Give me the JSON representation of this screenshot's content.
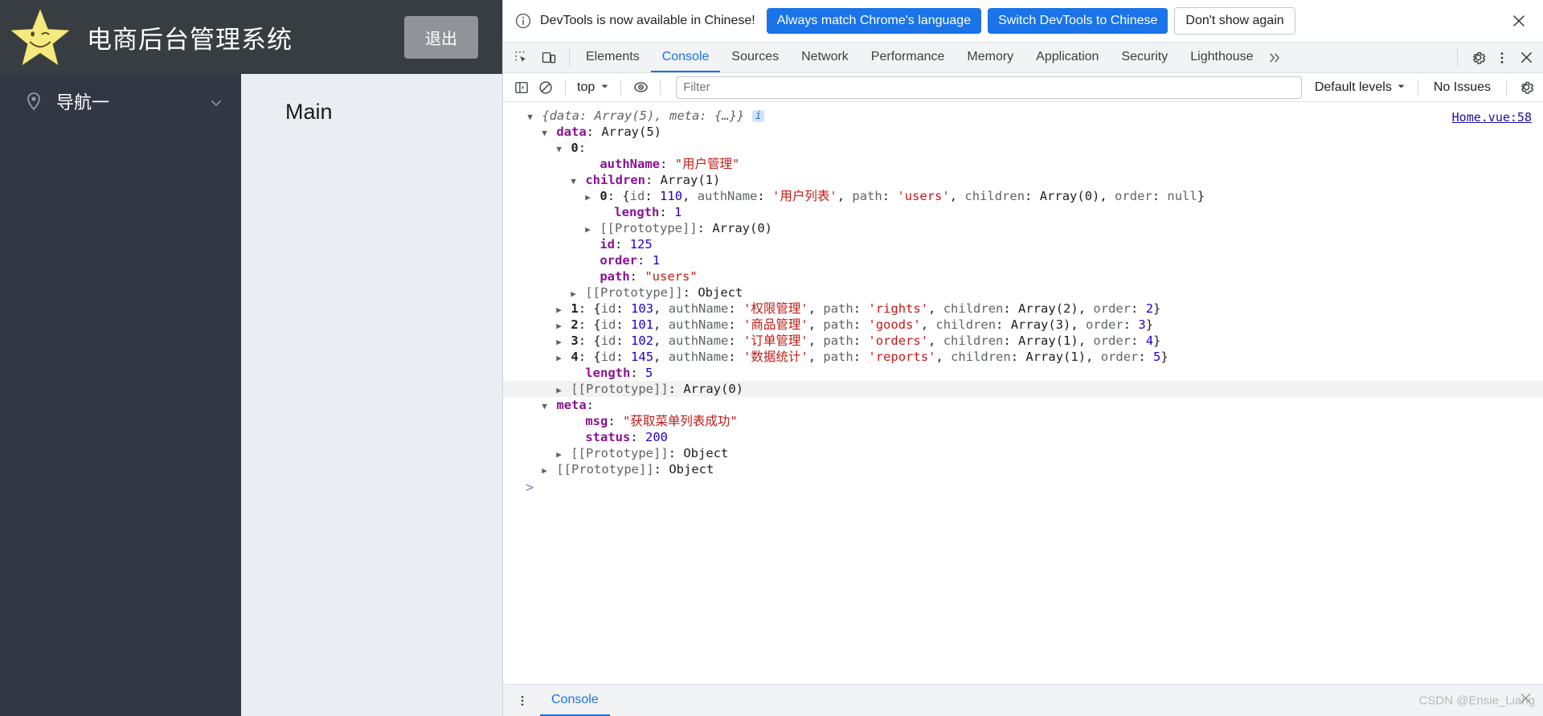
{
  "app": {
    "title": "电商后台管理系统",
    "logout_label": "退出",
    "logo": "star-smiley-logo",
    "sidebar": {
      "items": [
        {
          "label": "导航一",
          "icon": "location-pin-icon",
          "chevron": "chevron-down-icon"
        }
      ]
    },
    "main": {
      "heading": "Main"
    }
  },
  "devtools": {
    "infobar": {
      "icon": "info-circle-icon",
      "message": "DevTools is now available in Chinese!",
      "primary_button": "Always match Chrome's language",
      "secondary_button": "Switch DevTools to Chinese",
      "dismiss_button": "Don't show again",
      "close_icon": "close-icon"
    },
    "tabstrip": {
      "inspect_icon": "inspect-element-icon",
      "device_icon": "device-toolbar-icon",
      "tabs": [
        {
          "label": "Elements",
          "active": false
        },
        {
          "label": "Console",
          "active": true
        },
        {
          "label": "Sources",
          "active": false
        },
        {
          "label": "Network",
          "active": false
        },
        {
          "label": "Performance",
          "active": false
        },
        {
          "label": "Memory",
          "active": false
        },
        {
          "label": "Application",
          "active": false
        },
        {
          "label": "Security",
          "active": false
        },
        {
          "label": "Lighthouse",
          "active": false
        }
      ],
      "more_tabs_icon": "chevron-double-right-icon",
      "settings_icon": "gear-icon",
      "kebab_icon": "more-vertical-icon",
      "close_icon": "close-icon"
    },
    "console_toolbar": {
      "sidebar_icon": "console-sidebar-icon",
      "clear_icon": "clear-console-icon",
      "context_value": "top",
      "context_chevron": "chevron-down-icon",
      "eye_icon": "live-expression-eye-icon",
      "filter_placeholder": "Filter",
      "filter_value": "",
      "levels_value": "Default levels",
      "levels_chevron": "chevron-down-icon",
      "issues_label": "No Issues",
      "settings_icon": "gear-icon"
    },
    "console_output": {
      "source_link": "Home.vue:58",
      "lines": [
        {
          "id": "l0",
          "indent": 0,
          "arrow": "down",
          "tokens": [
            {
              "t": "{data: Array(5), meta: {…}} ",
              "c": "preview"
            },
            {
              "t": "i",
              "c": "badge"
            }
          ]
        },
        {
          "id": "l1",
          "indent": 1,
          "arrow": "down",
          "tokens": [
            {
              "t": "data",
              "c": "key"
            },
            {
              "t": ": ",
              "c": "plain"
            },
            {
              "t": "Array(5)",
              "c": "plain"
            }
          ]
        },
        {
          "id": "l2",
          "indent": 2,
          "arrow": "down",
          "tokens": [
            {
              "t": "0",
              "c": "idx"
            },
            {
              "t": ":",
              "c": "plain"
            }
          ]
        },
        {
          "id": "l3",
          "indent": 4,
          "arrow": "none",
          "tokens": [
            {
              "t": "authName",
              "c": "key"
            },
            {
              "t": ": ",
              "c": "plain"
            },
            {
              "t": "\"用户管理\"",
              "c": "str"
            }
          ]
        },
        {
          "id": "l4",
          "indent": 3,
          "arrow": "down",
          "tokens": [
            {
              "t": "children",
              "c": "key"
            },
            {
              "t": ": ",
              "c": "plain"
            },
            {
              "t": "Array(1)",
              "c": "plain"
            }
          ]
        },
        {
          "id": "l5",
          "indent": 4,
          "arrow": "right",
          "tokens": [
            {
              "t": "0",
              "c": "idx"
            },
            {
              "t": ": {",
              "c": "plain"
            },
            {
              "t": "id",
              "c": "grey"
            },
            {
              "t": ": ",
              "c": "plain"
            },
            {
              "t": "110",
              "c": "num"
            },
            {
              "t": ", ",
              "c": "plain"
            },
            {
              "t": "authName",
              "c": "grey"
            },
            {
              "t": ": ",
              "c": "plain"
            },
            {
              "t": "'用户列表'",
              "c": "str"
            },
            {
              "t": ", ",
              "c": "plain"
            },
            {
              "t": "path",
              "c": "grey"
            },
            {
              "t": ": ",
              "c": "plain"
            },
            {
              "t": "'users'",
              "c": "str"
            },
            {
              "t": ", ",
              "c": "plain"
            },
            {
              "t": "children",
              "c": "grey"
            },
            {
              "t": ": ",
              "c": "plain"
            },
            {
              "t": "Array(0)",
              "c": "plain"
            },
            {
              "t": ", ",
              "c": "plain"
            },
            {
              "t": "order",
              "c": "grey"
            },
            {
              "t": ": ",
              "c": "plain"
            },
            {
              "t": "null",
              "c": "null"
            },
            {
              "t": "}",
              "c": "plain"
            }
          ]
        },
        {
          "id": "l6",
          "indent": 5,
          "arrow": "none",
          "tokens": [
            {
              "t": "length",
              "c": "key"
            },
            {
              "t": ": ",
              "c": "plain"
            },
            {
              "t": "1",
              "c": "num"
            }
          ]
        },
        {
          "id": "l7",
          "indent": 4,
          "arrow": "right",
          "tokens": [
            {
              "t": "[[Prototype]]",
              "c": "grey"
            },
            {
              "t": ": ",
              "c": "plain"
            },
            {
              "t": "Array(0)",
              "c": "plain"
            }
          ]
        },
        {
          "id": "l8",
          "indent": 4,
          "arrow": "none",
          "tokens": [
            {
              "t": "id",
              "c": "key"
            },
            {
              "t": ": ",
              "c": "plain"
            },
            {
              "t": "125",
              "c": "num"
            }
          ]
        },
        {
          "id": "l9",
          "indent": 4,
          "arrow": "none",
          "tokens": [
            {
              "t": "order",
              "c": "key"
            },
            {
              "t": ": ",
              "c": "plain"
            },
            {
              "t": "1",
              "c": "num"
            }
          ]
        },
        {
          "id": "l10",
          "indent": 4,
          "arrow": "none",
          "tokens": [
            {
              "t": "path",
              "c": "key"
            },
            {
              "t": ": ",
              "c": "plain"
            },
            {
              "t": "\"users\"",
              "c": "str"
            }
          ]
        },
        {
          "id": "l11",
          "indent": 3,
          "arrow": "right",
          "tokens": [
            {
              "t": "[[Prototype]]",
              "c": "grey"
            },
            {
              "t": ": ",
              "c": "plain"
            },
            {
              "t": "Object",
              "c": "plain"
            }
          ]
        },
        {
          "id": "l12",
          "indent": 2,
          "arrow": "right",
          "tokens": [
            {
              "t": "1",
              "c": "idx"
            },
            {
              "t": ": {",
              "c": "plain"
            },
            {
              "t": "id",
              "c": "grey"
            },
            {
              "t": ": ",
              "c": "plain"
            },
            {
              "t": "103",
              "c": "num"
            },
            {
              "t": ", ",
              "c": "plain"
            },
            {
              "t": "authName",
              "c": "grey"
            },
            {
              "t": ": ",
              "c": "plain"
            },
            {
              "t": "'权限管理'",
              "c": "str"
            },
            {
              "t": ", ",
              "c": "plain"
            },
            {
              "t": "path",
              "c": "grey"
            },
            {
              "t": ": ",
              "c": "plain"
            },
            {
              "t": "'rights'",
              "c": "str"
            },
            {
              "t": ", ",
              "c": "plain"
            },
            {
              "t": "children",
              "c": "grey"
            },
            {
              "t": ": ",
              "c": "plain"
            },
            {
              "t": "Array(2)",
              "c": "plain"
            },
            {
              "t": ", ",
              "c": "plain"
            },
            {
              "t": "order",
              "c": "grey"
            },
            {
              "t": ": ",
              "c": "plain"
            },
            {
              "t": "2",
              "c": "num"
            },
            {
              "t": "}",
              "c": "plain"
            }
          ]
        },
        {
          "id": "l13",
          "indent": 2,
          "arrow": "right",
          "tokens": [
            {
              "t": "2",
              "c": "idx"
            },
            {
              "t": ": {",
              "c": "plain"
            },
            {
              "t": "id",
              "c": "grey"
            },
            {
              "t": ": ",
              "c": "plain"
            },
            {
              "t": "101",
              "c": "num"
            },
            {
              "t": ", ",
              "c": "plain"
            },
            {
              "t": "authName",
              "c": "grey"
            },
            {
              "t": ": ",
              "c": "plain"
            },
            {
              "t": "'商品管理'",
              "c": "str"
            },
            {
              "t": ", ",
              "c": "plain"
            },
            {
              "t": "path",
              "c": "grey"
            },
            {
              "t": ": ",
              "c": "plain"
            },
            {
              "t": "'goods'",
              "c": "str"
            },
            {
              "t": ", ",
              "c": "plain"
            },
            {
              "t": "children",
              "c": "grey"
            },
            {
              "t": ": ",
              "c": "plain"
            },
            {
              "t": "Array(3)",
              "c": "plain"
            },
            {
              "t": ", ",
              "c": "plain"
            },
            {
              "t": "order",
              "c": "grey"
            },
            {
              "t": ": ",
              "c": "plain"
            },
            {
              "t": "3",
              "c": "num"
            },
            {
              "t": "}",
              "c": "plain"
            }
          ]
        },
        {
          "id": "l14",
          "indent": 2,
          "arrow": "right",
          "tokens": [
            {
              "t": "3",
              "c": "idx"
            },
            {
              "t": ": {",
              "c": "plain"
            },
            {
              "t": "id",
              "c": "grey"
            },
            {
              "t": ": ",
              "c": "plain"
            },
            {
              "t": "102",
              "c": "num"
            },
            {
              "t": ", ",
              "c": "plain"
            },
            {
              "t": "authName",
              "c": "grey"
            },
            {
              "t": ": ",
              "c": "plain"
            },
            {
              "t": "'订单管理'",
              "c": "str"
            },
            {
              "t": ", ",
              "c": "plain"
            },
            {
              "t": "path",
              "c": "grey"
            },
            {
              "t": ": ",
              "c": "plain"
            },
            {
              "t": "'orders'",
              "c": "str"
            },
            {
              "t": ", ",
              "c": "plain"
            },
            {
              "t": "children",
              "c": "grey"
            },
            {
              "t": ": ",
              "c": "plain"
            },
            {
              "t": "Array(1)",
              "c": "plain"
            },
            {
              "t": ", ",
              "c": "plain"
            },
            {
              "t": "order",
              "c": "grey"
            },
            {
              "t": ": ",
              "c": "plain"
            },
            {
              "t": "4",
              "c": "num"
            },
            {
              "t": "}",
              "c": "plain"
            }
          ]
        },
        {
          "id": "l15",
          "indent": 2,
          "arrow": "right",
          "tokens": [
            {
              "t": "4",
              "c": "idx"
            },
            {
              "t": ": {",
              "c": "plain"
            },
            {
              "t": "id",
              "c": "grey"
            },
            {
              "t": ": ",
              "c": "plain"
            },
            {
              "t": "145",
              "c": "num"
            },
            {
              "t": ", ",
              "c": "plain"
            },
            {
              "t": "authName",
              "c": "grey"
            },
            {
              "t": ": ",
              "c": "plain"
            },
            {
              "t": "'数据统计'",
              "c": "str"
            },
            {
              "t": ", ",
              "c": "plain"
            },
            {
              "t": "path",
              "c": "grey"
            },
            {
              "t": ": ",
              "c": "plain"
            },
            {
              "t": "'reports'",
              "c": "str"
            },
            {
              "t": ", ",
              "c": "plain"
            },
            {
              "t": "children",
              "c": "grey"
            },
            {
              "t": ": ",
              "c": "plain"
            },
            {
              "t": "Array(1)",
              "c": "plain"
            },
            {
              "t": ", ",
              "c": "plain"
            },
            {
              "t": "order",
              "c": "grey"
            },
            {
              "t": ": ",
              "c": "plain"
            },
            {
              "t": "5",
              "c": "num"
            },
            {
              "t": "}",
              "c": "plain"
            }
          ]
        },
        {
          "id": "l16",
          "indent": 3,
          "arrow": "none",
          "tokens": [
            {
              "t": "length",
              "c": "key"
            },
            {
              "t": ": ",
              "c": "plain"
            },
            {
              "t": "5",
              "c": "num"
            }
          ]
        },
        {
          "id": "l17",
          "indent": 2,
          "arrow": "right",
          "hl": true,
          "tokens": [
            {
              "t": "[[Prototype]]",
              "c": "grey"
            },
            {
              "t": ": ",
              "c": "plain"
            },
            {
              "t": "Array(0)",
              "c": "plain"
            }
          ]
        },
        {
          "id": "l18",
          "indent": 1,
          "arrow": "down",
          "tokens": [
            {
              "t": "meta",
              "c": "key"
            },
            {
              "t": ":",
              "c": "plain"
            }
          ]
        },
        {
          "id": "l19",
          "indent": 3,
          "arrow": "none",
          "tokens": [
            {
              "t": "msg",
              "c": "key"
            },
            {
              "t": ": ",
              "c": "plain"
            },
            {
              "t": "\"获取菜单列表成功\"",
              "c": "str"
            }
          ]
        },
        {
          "id": "l20",
          "indent": 3,
          "arrow": "none",
          "tokens": [
            {
              "t": "status",
              "c": "key"
            },
            {
              "t": ": ",
              "c": "plain"
            },
            {
              "t": "200",
              "c": "num"
            }
          ]
        },
        {
          "id": "l21",
          "indent": 2,
          "arrow": "right",
          "tokens": [
            {
              "t": "[[Prototype]]",
              "c": "grey"
            },
            {
              "t": ": ",
              "c": "plain"
            },
            {
              "t": "Object",
              "c": "plain"
            }
          ]
        },
        {
          "id": "l22",
          "indent": 1,
          "arrow": "right",
          "tokens": [
            {
              "t": "[[Prototype]]",
              "c": "grey"
            },
            {
              "t": ": ",
              "c": "plain"
            },
            {
              "t": "Object",
              "c": "plain"
            }
          ]
        }
      ],
      "prompt_caret": ">"
    },
    "drawer": {
      "menu_icon": "more-vertical-icon",
      "tab_label": "Console"
    }
  },
  "watermark": {
    "text": "CSDN @Ensie_Liang",
    "close_icon": "close-icon"
  },
  "colors": {
    "header_bg": "#373d41",
    "sidebar_bg": "#333744",
    "main_bg": "#eaedf1",
    "accent_blue": "#1a73e8",
    "logout_btn": "#909399",
    "string_red": "#c41a16",
    "key_purple": "#881391",
    "number_blue": "#1c00cf"
  }
}
